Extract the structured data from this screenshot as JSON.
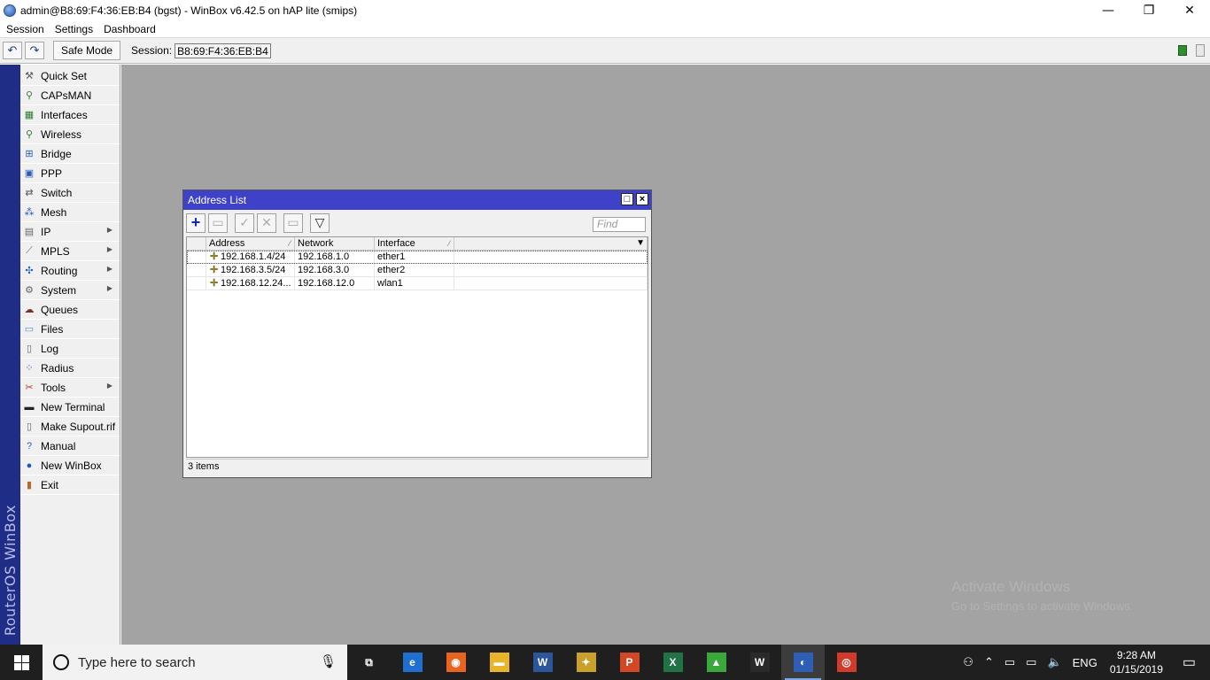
{
  "window": {
    "title": "admin@B8:69:F4:36:EB:B4 (bgst) - WinBox v6.42.5 on hAP lite (smips)",
    "minimize": "—",
    "maximize": "❐",
    "close": "✕"
  },
  "menu": [
    "Session",
    "Settings",
    "Dashboard"
  ],
  "toolbar": {
    "undo": "↶",
    "redo": "↷",
    "safe_mode": "Safe Mode",
    "session_label": "Session:",
    "session_value": "B8:69:F4:36:EB:B4"
  },
  "brand": "RouterOS WinBox",
  "sidemenu": [
    {
      "label": "Quick Set",
      "icon": "quick-set-icon",
      "glyph": "⚒",
      "color": "#5a5a5a",
      "submenu": false
    },
    {
      "label": "CAPsMAN",
      "icon": "capsman-icon",
      "glyph": "⚲",
      "color": "#3a7a3a",
      "submenu": false
    },
    {
      "label": "Interfaces",
      "icon": "interfaces-icon",
      "glyph": "▦",
      "color": "#2f7a2f",
      "submenu": false
    },
    {
      "label": "Wireless",
      "icon": "wireless-icon",
      "glyph": "⚲",
      "color": "#3a7a3a",
      "submenu": false
    },
    {
      "label": "Bridge",
      "icon": "bridge-icon",
      "glyph": "⊞",
      "color": "#2a5ab5",
      "submenu": false
    },
    {
      "label": "PPP",
      "icon": "ppp-icon",
      "glyph": "▣",
      "color": "#2a5ab5",
      "submenu": false
    },
    {
      "label": "Switch",
      "icon": "switch-icon",
      "glyph": "⇄",
      "color": "#555555",
      "submenu": false
    },
    {
      "label": "Mesh",
      "icon": "mesh-icon",
      "glyph": "⁂",
      "color": "#2a5ab5",
      "submenu": false
    },
    {
      "label": "IP",
      "icon": "ip-icon",
      "glyph": "▤",
      "color": "#666666",
      "submenu": true
    },
    {
      "label": "MPLS",
      "icon": "mpls-icon",
      "glyph": "⟋",
      "color": "#666666",
      "submenu": true
    },
    {
      "label": "Routing",
      "icon": "routing-icon",
      "glyph": "✣",
      "color": "#2a5ab5",
      "submenu": true
    },
    {
      "label": "System",
      "icon": "system-icon",
      "glyph": "⚙",
      "color": "#666666",
      "submenu": true
    },
    {
      "label": "Queues",
      "icon": "queues-icon",
      "glyph": "☁",
      "color": "#7a2f1f",
      "submenu": false
    },
    {
      "label": "Files",
      "icon": "files-icon",
      "glyph": "▭",
      "color": "#5a8ac8",
      "submenu": false
    },
    {
      "label": "Log",
      "icon": "log-icon",
      "glyph": "▯",
      "color": "#666666",
      "submenu": false
    },
    {
      "label": "Radius",
      "icon": "radius-icon",
      "glyph": "⁘",
      "color": "#2a5ab5",
      "submenu": false
    },
    {
      "label": "Tools",
      "icon": "tools-icon",
      "glyph": "✂",
      "color": "#b53a2a",
      "submenu": true
    },
    {
      "label": "New Terminal",
      "icon": "terminal-icon",
      "glyph": "▬",
      "color": "#222222",
      "submenu": false
    },
    {
      "label": "Make Supout.rif",
      "icon": "supout-icon",
      "glyph": "▯",
      "color": "#666666",
      "submenu": false
    },
    {
      "label": "Manual",
      "icon": "manual-icon",
      "glyph": "?",
      "color": "#2a5ab5",
      "submenu": false
    },
    {
      "label": "New WinBox",
      "icon": "winbox-icon",
      "glyph": "●",
      "color": "#1f58b5",
      "submenu": false
    },
    {
      "label": "Exit",
      "icon": "exit-icon",
      "glyph": "▮",
      "color": "#b56a2a",
      "submenu": false
    }
  ],
  "address_list": {
    "title": "Address List",
    "find_placeholder": "Find",
    "columns": [
      "Address",
      "Network",
      "Interface"
    ],
    "rows": [
      {
        "address": "192.168.1.4/24",
        "network": "192.168.1.0",
        "interface": "ether1"
      },
      {
        "address": "192.168.3.5/24",
        "network": "192.168.3.0",
        "interface": "ether2"
      },
      {
        "address": "192.168.12.24...",
        "network": "192.168.12.0",
        "interface": "wlan1"
      }
    ],
    "status": "3 items"
  },
  "watermark": {
    "line1": "Activate Windows",
    "line2": "Go to Settings to activate Windows."
  },
  "taskbar": {
    "search_placeholder": "Type here to search",
    "apps": [
      {
        "name": "task-view-icon",
        "glyph": "⧉",
        "bg": "transparent"
      },
      {
        "name": "edge-icon",
        "glyph": "e",
        "bg": "#1f6fd1"
      },
      {
        "name": "firefox-icon",
        "glyph": "◉",
        "bg": "#e8641f"
      },
      {
        "name": "file-explorer-icon",
        "glyph": "▬",
        "bg": "#e8b52a"
      },
      {
        "name": "word-icon",
        "glyph": "W",
        "bg": "#2b579a"
      },
      {
        "name": "app-icon",
        "glyph": "✦",
        "bg": "#c8a02a"
      },
      {
        "name": "powerpoint-icon",
        "glyph": "P",
        "bg": "#d24726"
      },
      {
        "name": "excel-icon",
        "glyph": "X",
        "bg": "#217346"
      },
      {
        "name": "green-app-icon",
        "glyph": "▲",
        "bg": "#3aa83a"
      },
      {
        "name": "winbox-taskbar-icon",
        "glyph": "W",
        "bg": "#2a2a2a"
      },
      {
        "name": "winbox-active-icon",
        "glyph": "◐",
        "bg": "#2f5fb5",
        "active": true
      },
      {
        "name": "chrome-icon",
        "glyph": "◎",
        "bg": "#d23a2a"
      }
    ],
    "language": "ENG",
    "time": "9:28 AM",
    "date": "01/15/2019"
  }
}
